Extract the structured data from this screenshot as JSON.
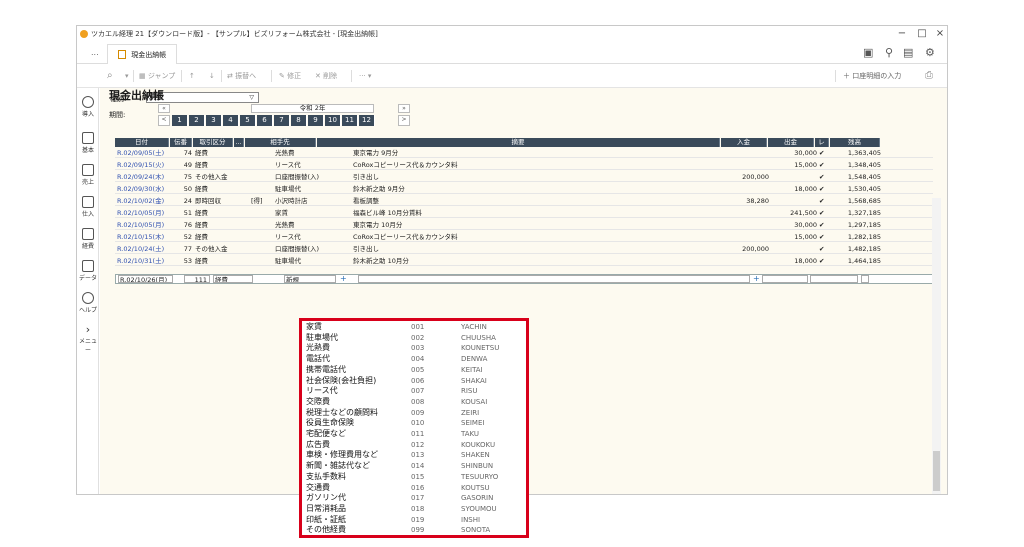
{
  "window": {
    "title": "ツカエル経理 21【ダウンロード版】- 【サンプル】ビズリフォーム株式会社 - [現金出納帳]",
    "controls": [
      "−",
      "□",
      "×"
    ]
  },
  "tabs": {
    "more": "...",
    "active_tab": "現金出納帳"
  },
  "toolbar": {
    "jump": "ジャンプ",
    "up": "↑",
    "down": "↓",
    "transfer": "振替へ",
    "edit": "修正",
    "delete": "削除",
    "more": "··· ▾",
    "bank_input": "＋ 口座明細の入力"
  },
  "sidebar": [
    {
      "label": "導入",
      "icon": "gear-icon"
    },
    {
      "label": "基本",
      "icon": "home-icon"
    },
    {
      "label": "売上",
      "icon": "register-icon"
    },
    {
      "label": "仕入",
      "icon": "cart-icon"
    },
    {
      "label": "経費",
      "icon": "wallet-icon"
    },
    {
      "label": "データ",
      "icon": "folder-icon"
    },
    {
      "label": "ヘルプ",
      "icon": "help-icon"
    },
    {
      "label": "メニュー",
      "icon": "chevron-right-icon"
    }
  ],
  "kind": {
    "label": "種別:",
    "value": "現金"
  },
  "ledger_title": "現金出納帳",
  "period": {
    "label": "期間:",
    "era": "令和 2年",
    "prev": "«",
    "next": "»",
    "prev_small": "<",
    "next_small": ">",
    "months": [
      "1",
      "2",
      "3",
      "4",
      "5",
      "6",
      "7",
      "8",
      "9",
      "10",
      "11",
      "12"
    ]
  },
  "columns": [
    "日付",
    "伝番",
    "取引区分",
    "…",
    "相手先",
    "摘要",
    "入金",
    "出金",
    "レ",
    "残高"
  ],
  "rows": [
    {
      "date": "R.02/09/05(土)",
      "no": "74",
      "kind": "経費",
      "partner": "",
      "account": "光熱費",
      "memo": "東京電力 9月分",
      "in": "",
      "out": "30,000",
      "chk": "✔",
      "bal": "1,363,405"
    },
    {
      "date": "R.02/09/15(火)",
      "no": "49",
      "kind": "経費",
      "partner": "",
      "account": "リース代",
      "memo": "CoRoxコピーリース代＆カウンタ料",
      "in": "",
      "out": "15,000",
      "chk": "✔",
      "bal": "1,348,405"
    },
    {
      "date": "R.02/09/24(木)",
      "no": "75",
      "kind": "その他入金",
      "partner": "",
      "account": "口座間振替(入)",
      "memo": "引き出し",
      "in": "200,000",
      "out": "",
      "chk": "✔",
      "bal": "1,548,405"
    },
    {
      "date": "R.02/09/30(水)",
      "no": "50",
      "kind": "経費",
      "partner": "",
      "account": "駐車場代",
      "memo": "鈴木新之助 9月分",
      "in": "",
      "out": "18,000",
      "chk": "✔",
      "bal": "1,530,405"
    },
    {
      "date": "R.02/10/02(金)",
      "no": "24",
      "kind": "即時回収",
      "partner": "[得]",
      "account": "小沢時計店",
      "memo": "看板調整",
      "in": "38,280",
      "out": "",
      "chk": "✔",
      "bal": "1,568,685"
    },
    {
      "date": "R.02/10/05(月)",
      "no": "51",
      "kind": "経費",
      "partner": "",
      "account": "家賃",
      "memo": "福森ビル峰 10月分賃料",
      "in": "",
      "out": "241,500",
      "chk": "✔",
      "bal": "1,327,185"
    },
    {
      "date": "R.02/10/05(月)",
      "no": "76",
      "kind": "経費",
      "partner": "",
      "account": "光熱費",
      "memo": "東京電力 10月分",
      "in": "",
      "out": "30,000",
      "chk": "✔",
      "bal": "1,297,185"
    },
    {
      "date": "R.02/10/15(木)",
      "no": "52",
      "kind": "経費",
      "partner": "",
      "account": "リース代",
      "memo": "CoRoxコピーリース代＆カウンタ料",
      "in": "",
      "out": "15,000",
      "chk": "✔",
      "bal": "1,282,185"
    },
    {
      "date": "R.02/10/24(土)",
      "no": "77",
      "kind": "その他入金",
      "partner": "",
      "account": "口座間振替(入)",
      "memo": "引き出し",
      "in": "200,000",
      "out": "",
      "chk": "✔",
      "bal": "1,482,185"
    },
    {
      "date": "R.02/10/31(土)",
      "no": "53",
      "kind": "経費",
      "partner": "",
      "account": "駐車場代",
      "memo": "鈴木新之助 10月分",
      "in": "",
      "out": "18,000",
      "chk": "✔",
      "bal": "1,464,185"
    }
  ],
  "edit_row": {
    "date": "R.02/10/26(月)",
    "no": "111",
    "kind": "経費",
    "account": "新規",
    "plus": "+"
  },
  "dropdown_items": [
    {
      "name": "家賃",
      "code": "001",
      "kana": "YACHIN"
    },
    {
      "name": "駐車場代",
      "code": "002",
      "kana": "CHUUSHA"
    },
    {
      "name": "光熱費",
      "code": "003",
      "kana": "KOUNETSU"
    },
    {
      "name": "電話代",
      "code": "004",
      "kana": "DENWA"
    },
    {
      "name": "携帯電話代",
      "code": "005",
      "kana": "KEITAI"
    },
    {
      "name": "社会保険(会社負担)",
      "code": "006",
      "kana": "SHAKAI"
    },
    {
      "name": "リース代",
      "code": "007",
      "kana": "RISU"
    },
    {
      "name": "交際費",
      "code": "008",
      "kana": "KOUSAI"
    },
    {
      "name": "税理士などの顧問料",
      "code": "009",
      "kana": "ZEIRI"
    },
    {
      "name": "役員生命保険",
      "code": "010",
      "kana": "SEIMEI"
    },
    {
      "name": "宅配便など",
      "code": "011",
      "kana": "TAKU"
    },
    {
      "name": "広告費",
      "code": "012",
      "kana": "KOUKOKU"
    },
    {
      "name": "車検・修理費用など",
      "code": "013",
      "kana": "SHAKEN"
    },
    {
      "name": "新聞・雑誌代など",
      "code": "014",
      "kana": "SHINBUN"
    },
    {
      "name": "支払手数料",
      "code": "015",
      "kana": "TESUURYO"
    },
    {
      "name": "交通費",
      "code": "016",
      "kana": "KOUTSU"
    },
    {
      "name": "ガソリン代",
      "code": "017",
      "kana": "GASORIN"
    },
    {
      "name": "日常消耗品",
      "code": "018",
      "kana": "SYOUMOU"
    },
    {
      "name": "印紙・証紙",
      "code": "019",
      "kana": "INSHI"
    },
    {
      "name": "その他経費",
      "code": "099",
      "kana": "SONOTA"
    }
  ],
  "colors": {
    "header_bg": "#3a4a5a",
    "highlight": "#d8001a",
    "ledger_bg": "#fdfaf0"
  }
}
